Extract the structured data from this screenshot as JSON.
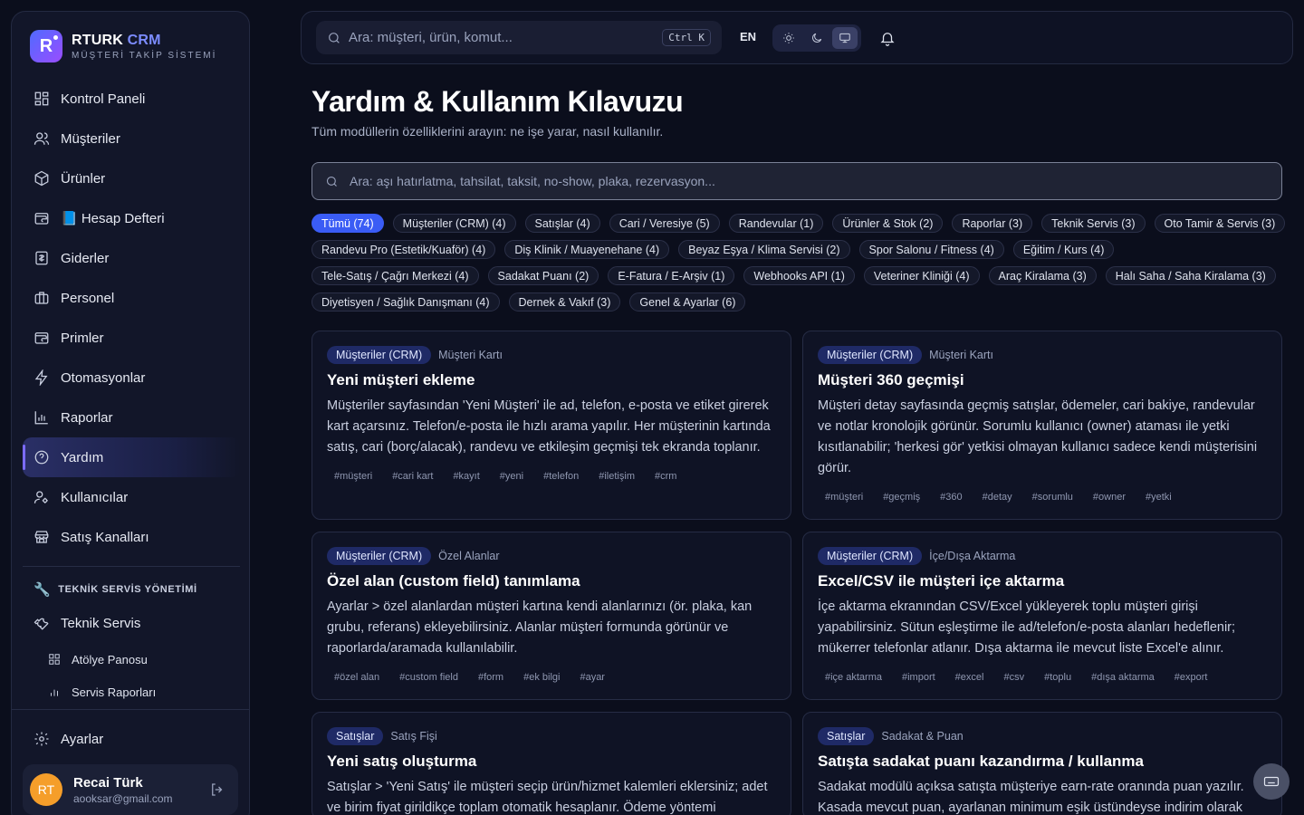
{
  "brand": {
    "name_a": "RTURK",
    "name_b": "CRM",
    "subtitle": "MÜŞTERİ TAKİP SİSTEMİ",
    "logo_letter": "R"
  },
  "sidebar": {
    "items": [
      {
        "label": "Kontrol Paneli",
        "icon": "dashboard-icon"
      },
      {
        "label": "Müşteriler",
        "icon": "users-icon"
      },
      {
        "label": "Ürünler",
        "icon": "box-icon"
      },
      {
        "label": "📘 Hesap Defteri",
        "icon": "wallet-icon"
      },
      {
        "label": "Giderler",
        "icon": "receipt-icon"
      },
      {
        "label": "Personel",
        "icon": "briefcase-icon"
      },
      {
        "label": "Primler",
        "icon": "wallet-icon"
      },
      {
        "label": "Otomasyonlar",
        "icon": "bolt-icon"
      },
      {
        "label": "Raporlar",
        "icon": "chart-icon"
      },
      {
        "label": "Yardım",
        "icon": "help-icon",
        "active": true
      },
      {
        "label": "Kullanıcılar",
        "icon": "user-key-icon"
      },
      {
        "label": "Satış Kanalları",
        "icon": "store-icon"
      }
    ],
    "section_label": "TEKNİK SERVİS YÖNETİMİ",
    "service_item": "Teknik Servis",
    "sub_items": [
      "Atölye Panosu",
      "Servis Raporları"
    ],
    "settings": "Ayarlar",
    "user": {
      "initials": "RT",
      "name": "Recai Türk",
      "email": "aooksar@gmail.com"
    }
  },
  "topbar": {
    "search_placeholder": "Ara: müşteri, ürün, komut...",
    "shortcut": "Ctrl K",
    "lang": "EN"
  },
  "main": {
    "title": "Yardım & Kullanım Kılavuzu",
    "subtitle": "Tüm modüllerin özelliklerini arayın: ne işe yarar, nasıl kullanılır.",
    "search_placeholder": "Ara: aşı hatırlatma, tahsilat, taksit, no-show, plaka, rezervasyon...",
    "filters": [
      "Tümü (74)",
      "Müşteriler (CRM) (4)",
      "Satışlar (4)",
      "Cari / Veresiye (5)",
      "Randevular (1)",
      "Ürünler & Stok (2)",
      "Raporlar (3)",
      "Teknik Servis (3)",
      "Oto Tamir & Servis (3)",
      "Randevu Pro (Estetik/Kuaför) (4)",
      "Diş Klinik / Muayenehane (4)",
      "Beyaz Eşya / Klima Servisi (2)",
      "Spor Salonu / Fitness (4)",
      "Eğitim / Kurs (4)",
      "Tele-Satış / Çağrı Merkezi (4)",
      "Sadakat Puanı (2)",
      "E-Fatura / E-Arşiv (1)",
      "Webhooks API (1)",
      "Veteriner Kliniği (4)",
      "Araç Kiralama (3)",
      "Halı Saha / Saha Kiralama (3)",
      "Diyetisyen / Sağlık Danışmanı (4)",
      "Dernek & Vakıf (3)",
      "Genel & Ayarlar (6)"
    ],
    "cards": [
      {
        "badge": "Müşteriler (CRM)",
        "sub": "Müşteri Kartı",
        "title": "Yeni müşteri ekleme",
        "desc": "Müşteriler sayfasından 'Yeni Müşteri' ile ad, telefon, e-posta ve etiket girerek kart açarsınız. Telefon/e-posta ile hızlı arama yapılır. Her müşterinin kartında satış, cari (borç/alacak), randevu ve etkileşim geçmişi tek ekranda toplanır.",
        "tags": [
          "#müşteri",
          "#cari kart",
          "#kayıt",
          "#yeni",
          "#telefon",
          "#iletişim",
          "#crm"
        ]
      },
      {
        "badge": "Müşteriler (CRM)",
        "sub": "Müşteri Kartı",
        "title": "Müşteri 360 geçmişi",
        "desc": "Müşteri detay sayfasında geçmiş satışlar, ödemeler, cari bakiye, randevular ve notlar kronolojik görünür. Sorumlu kullanıcı (owner) ataması ile yetki kısıtlanabilir; 'herkesi gör' yetkisi olmayan kullanıcı sadece kendi müşterisini görür.",
        "tags": [
          "#müşteri",
          "#geçmiş",
          "#360",
          "#detay",
          "#sorumlu",
          "#owner",
          "#yetki"
        ]
      },
      {
        "badge": "Müşteriler (CRM)",
        "sub": "Özel Alanlar",
        "title": "Özel alan (custom field) tanımlama",
        "desc": "Ayarlar > özel alanlardan müşteri kartına kendi alanlarınızı (ör. plaka, kan grubu, referans) ekleyebilirsiniz. Alanlar müşteri formunda görünür ve raporlarda/aramada kullanılabilir.",
        "tags": [
          "#özel alan",
          "#custom field",
          "#form",
          "#ek bilgi",
          "#ayar"
        ]
      },
      {
        "badge": "Müşteriler (CRM)",
        "sub": "İçe/Dışa Aktarma",
        "title": "Excel/CSV ile müşteri içe aktarma",
        "desc": "İçe aktarma ekranından CSV/Excel yükleyerek toplu müşteri girişi yapabilirsiniz. Sütun eşleştirme ile ad/telefon/e-posta alanları hedeflenir; mükerrer telefonlar atlanır. Dışa aktarma ile mevcut liste Excel'e alınır.",
        "tags": [
          "#içe aktarma",
          "#import",
          "#excel",
          "#csv",
          "#toplu",
          "#dışa aktarma",
          "#export"
        ]
      },
      {
        "badge": "Satışlar",
        "sub": "Satış Fişi",
        "title": "Yeni satış oluşturma",
        "desc": "Satışlar > 'Yeni Satış' ile müşteri seçip ürün/hizmet kalemleri eklersiniz; adet ve birim fiyat girildikçe toplam otomatik hesaplanır. Ödeme yöntemi",
        "tags": []
      },
      {
        "badge": "Satışlar",
        "sub": "Sadakat & Puan",
        "title": "Satışta sadakat puanı kazandırma / kullanma",
        "desc": "Sadakat modülü açıksa satışta müşteriye earn-rate oranında puan yazılır. Kasada mevcut puan, ayarlanan minimum eşik üstündeyse indirim olarak",
        "tags": []
      }
    ]
  }
}
